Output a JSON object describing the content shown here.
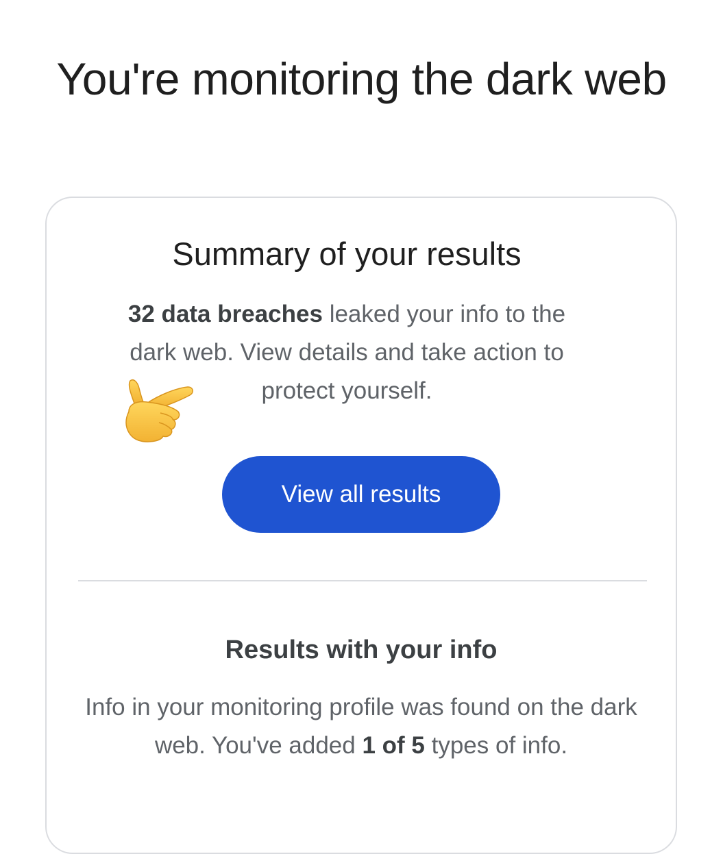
{
  "page": {
    "title": "You're monitoring the dark web"
  },
  "summary": {
    "heading": "Summary of your results",
    "breach_count_text": "32 data breaches",
    "body_before_line_break": " leaked your info to the",
    "body_rest": "dark web. View details and take action to",
    "body_last": "protect yourself.",
    "button_label": "View all results"
  },
  "info_section": {
    "heading": "Results with your info",
    "body_start": "Info in your monitoring profile was found on the dark web. You've added ",
    "count_text": "1 of 5",
    "body_end": " types of info."
  },
  "colors": {
    "button": "#1f54d1",
    "card_border": "#dadce0",
    "body_text": "#5f6368"
  },
  "icons": {
    "pointing_hand": "backhand-index-pointing-right-icon"
  }
}
